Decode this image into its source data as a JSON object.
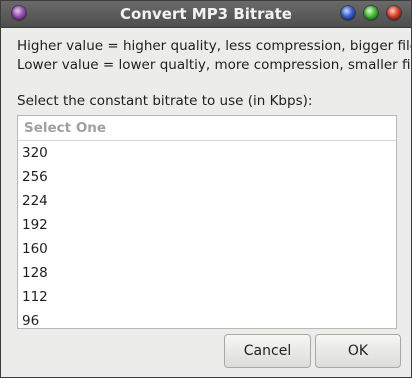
{
  "window": {
    "title": "Convert MP3 Bitrate"
  },
  "description": {
    "line1": "Higher value = higher quality, less compression, bigger file.",
    "line2": "Lower value = lower qualtiy, more compression, smaller file."
  },
  "prompt": "Select the constant bitrate to use (in Kbps):",
  "list": {
    "header": "Select One",
    "items": [
      "320",
      "256",
      "224",
      "192",
      "160",
      "128",
      "112",
      "96"
    ]
  },
  "buttons": {
    "cancel": "Cancel",
    "ok": "OK"
  }
}
